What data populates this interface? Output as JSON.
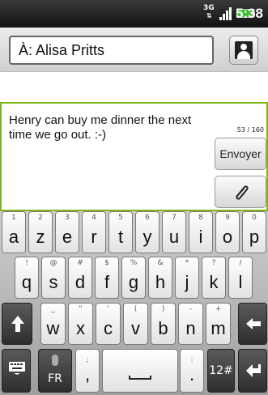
{
  "status_bar": {
    "network": "3G",
    "time": "5:38"
  },
  "recipient": {
    "text": "À: Alisa Pritts"
  },
  "composer": {
    "message": "Henry can buy me dinner the next time we go out.  :-)",
    "counter": "53 / 160",
    "send_label": "Envoyer"
  },
  "keyboard": {
    "row1": [
      {
        "alt": "1",
        "main": "a"
      },
      {
        "alt": "2",
        "main": "z"
      },
      {
        "alt": "3",
        "main": "e"
      },
      {
        "alt": "4",
        "main": "r"
      },
      {
        "alt": "5",
        "main": "t"
      },
      {
        "alt": "6",
        "main": "y"
      },
      {
        "alt": "7",
        "main": "u"
      },
      {
        "alt": "8",
        "main": "i"
      },
      {
        "alt": "9",
        "main": "o"
      },
      {
        "alt": "0",
        "main": "p"
      }
    ],
    "row2": [
      {
        "alt": "!",
        "main": "q"
      },
      {
        "alt": "@",
        "main": "s"
      },
      {
        "alt": "#",
        "main": "d"
      },
      {
        "alt": "$",
        "main": "f"
      },
      {
        "alt": "%",
        "main": "g"
      },
      {
        "alt": "&",
        "main": "h"
      },
      {
        "alt": "*",
        "main": "j"
      },
      {
        "alt": "?",
        "main": "k"
      },
      {
        "alt": "/",
        "main": "l"
      }
    ],
    "row3": [
      {
        "alt": "_",
        "main": "w"
      },
      {
        "alt": "\"",
        "main": "x"
      },
      {
        "alt": "'",
        "main": "c"
      },
      {
        "alt": "(",
        "main": "v"
      },
      {
        "alt": ")",
        "main": "b"
      },
      {
        "alt": "-",
        "main": "n"
      },
      {
        "alt": "+",
        "main": "m"
      }
    ],
    "row4": {
      "lang": "FR",
      "comma_alt": ";",
      "comma": ",",
      "period_alt": ":",
      "period": ".",
      "numbers": "12#"
    }
  },
  "colors": {
    "composer_border": "#7fb51a",
    "battery": "#3ec12e"
  }
}
